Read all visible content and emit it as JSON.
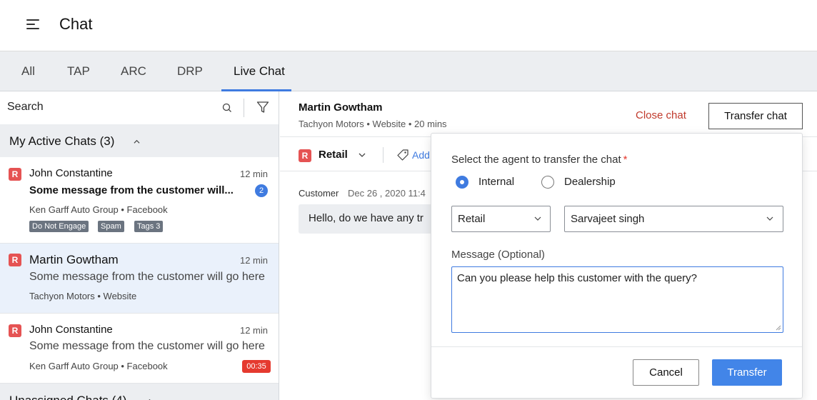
{
  "header": {
    "title": "Chat"
  },
  "tabs": [
    {
      "label": "All"
    },
    {
      "label": "TAP"
    },
    {
      "label": "ARC"
    },
    {
      "label": "DRP"
    },
    {
      "label": "Live Chat",
      "active": true
    }
  ],
  "sidebar": {
    "search_placeholder": "Search",
    "active_section": "My Active Chats (3)",
    "unassigned_section": "Unassigned Chats (4)",
    "chats": [
      {
        "badge": "R",
        "name": "John Constantine",
        "time": "12 min",
        "message": "Some message from the customer will...",
        "meta": "Ken Garff Auto Group • Facebook",
        "unread": "2",
        "tags": [
          "Do Not Engage",
          "Spam",
          "Tags 3"
        ]
      },
      {
        "badge": "R",
        "name": "Martin Gowtham",
        "time": "12 min",
        "message": "Some message from the customer will go here",
        "meta": "Tachyon Motors • Website"
      },
      {
        "badge": "R",
        "name": "John Constantine",
        "time": "12 min",
        "message": "Some message from the customer will go here",
        "meta": "Ken Garff Auto Group • Facebook",
        "timer": "00:35"
      }
    ]
  },
  "conversation": {
    "name": "Martin Gowtham",
    "meta": "Tachyon Motors • Website • 20 mins",
    "close_label": "Close chat",
    "transfer_label": "Transfer chat",
    "dept_badge": "R",
    "dept_label": "Retail",
    "add_label": "Add",
    "message": {
      "sender": "Customer",
      "date": "Dec 26 , 2020  11:4",
      "text": "Hello, do we have any tr"
    }
  },
  "transfer_popover": {
    "prompt": "Select the agent to transfer the chat",
    "required_mark": "*",
    "radio_internal": "Internal",
    "radio_dealership": "Dealership",
    "selected_radio": "Internal",
    "department_value": "Retail",
    "agent_value": "Sarvajeet singh",
    "message_label": "Message (Optional)",
    "message_value": "Can you please help this customer with the query?",
    "cancel_label": "Cancel",
    "submit_label": "Transfer"
  },
  "colors": {
    "accent": "#3f7be0",
    "badge_red": "#e55353",
    "close_red": "#c0392b",
    "tag_gray": "#6b7480",
    "timer_red": "#e53a2f"
  }
}
